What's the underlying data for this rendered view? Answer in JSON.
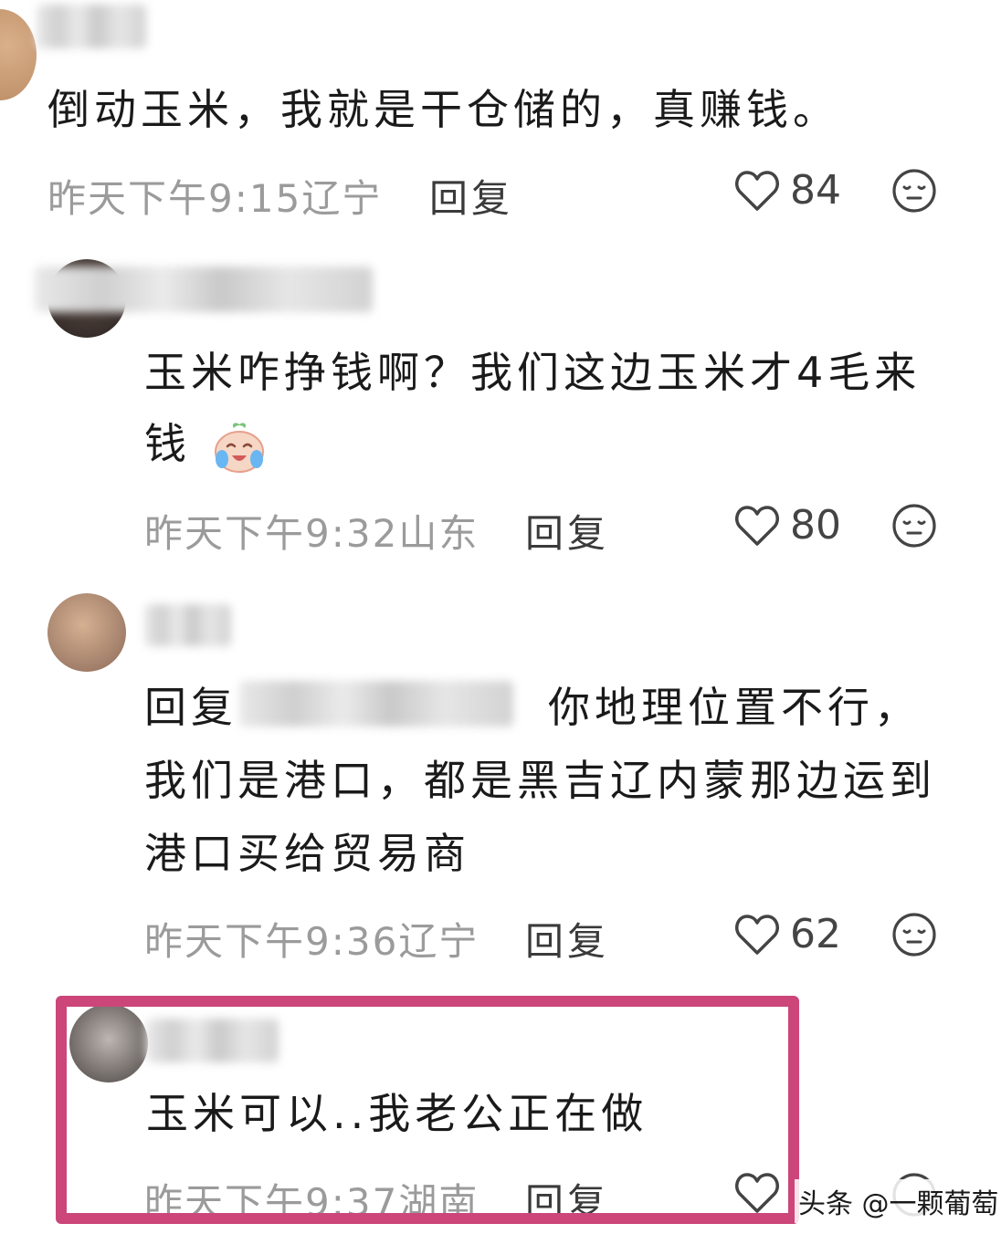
{
  "comments": [
    {
      "text": "倒动玉米，我就是干仓储的，真赚钱。",
      "time": "昨天下午9:15",
      "location": "辽宁",
      "reply_label": "回复",
      "likes": "84"
    },
    {
      "text_line1": "玉米咋挣钱啊？我们这边玉米才4毛来",
      "text_line2": "钱",
      "emoji": "crying-laughing-emoji",
      "time": "昨天下午9:32",
      "location": "山东",
      "reply_label": "回复",
      "likes": "80"
    },
    {
      "reply_prefix": "回复",
      "text_line1_rest": "你地理位置不行，",
      "text_line2": "我们是港口，都是黑吉辽内蒙那边运到",
      "text_line3": "港口买给贸易商",
      "time": "昨天下午9:36",
      "location": "辽宁",
      "reply_label": "回复",
      "likes": "62"
    },
    {
      "text": "玉米可以..我老公正在做",
      "time": "昨天下午9:37",
      "location": "湖南",
      "reply_label": "回复"
    }
  ],
  "watermark": "头条 @一颗葡萄",
  "colors": {
    "highlight_border": "#cc467a",
    "meta_text": "#9b9b9b",
    "text": "#1a1a1a"
  },
  "icons": {
    "like": "heart-outline-icon",
    "reaction": "meh-face-icon"
  }
}
